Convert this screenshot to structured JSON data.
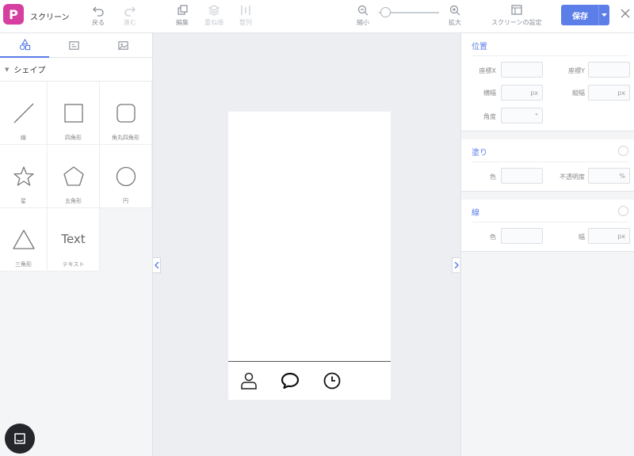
{
  "app": {
    "logo_letter": "P",
    "title": "スクリーン",
    "accent": "#5b7ee8",
    "logo_color": "#d63fa0"
  },
  "toolbar": {
    "undo": "戻る",
    "redo": "進む",
    "edit": "編集",
    "order": "重ね順",
    "align": "整列",
    "zoom_out": "縮小",
    "zoom_in": "拡大",
    "screen_settings": "スクリーンの設定",
    "save": "保存",
    "zoom_level": 0.1
  },
  "left_panel": {
    "tabs": [
      "shapes-icon",
      "component-icon",
      "image-icon"
    ],
    "section_title": "シェイプ",
    "shapes": [
      {
        "label": "線",
        "icon": "line-icon"
      },
      {
        "label": "四角形",
        "icon": "square-icon"
      },
      {
        "label": "角丸四角形",
        "icon": "rounded-square-icon"
      },
      {
        "label": "星",
        "icon": "star-icon"
      },
      {
        "label": "五角形",
        "icon": "pentagon-icon"
      },
      {
        "label": "円",
        "icon": "circle-icon"
      },
      {
        "label": "三角形",
        "icon": "triangle-icon"
      },
      {
        "label": "テキスト",
        "icon": "text-icon",
        "glyph": "Text"
      }
    ]
  },
  "right_panel": {
    "position": {
      "title": "位置",
      "x_label": "座標X",
      "y_label": "座標Y",
      "width_label": "横幅",
      "height_label": "縦幅",
      "angle_label": "角度",
      "px_unit": "px",
      "deg_unit": "°"
    },
    "fill": {
      "title": "塗り",
      "color_label": "色",
      "opacity_label": "不透明度",
      "percent_unit": "%"
    },
    "stroke": {
      "title": "線",
      "color_label": "色",
      "width_label": "幅",
      "px_unit": "px"
    }
  }
}
